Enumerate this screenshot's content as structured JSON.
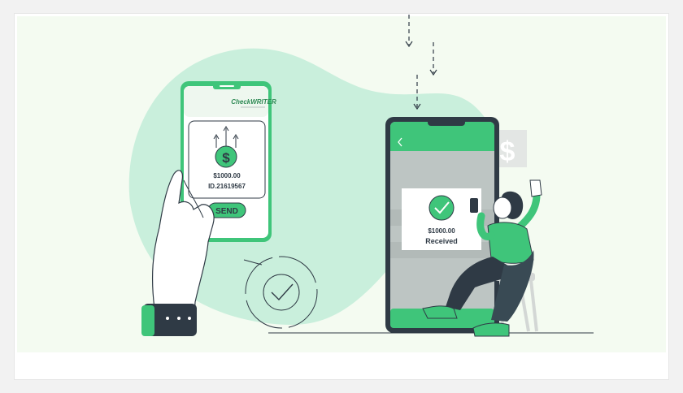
{
  "illustration": {
    "sender_phone": {
      "brand": "CheckWRITER",
      "amount": "$1000.00",
      "id": "ID.21619567",
      "send_label": "SEND",
      "dollar_symbol": "$"
    },
    "receiver_phone": {
      "amount": "$1000.00",
      "status": "Received",
      "bg_dollar": "$"
    }
  },
  "colors": {
    "accent": "#3fc57a",
    "dark": "#2f3a45",
    "blob": "#c9efdc",
    "panel_bg": "#f4fbf1",
    "skin": "#ffffff"
  }
}
